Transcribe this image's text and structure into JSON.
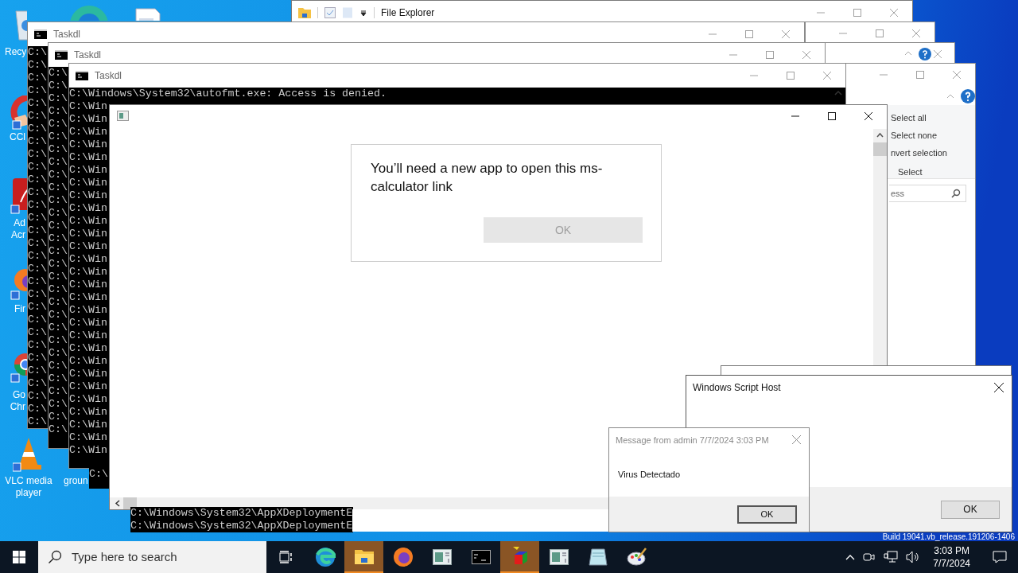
{
  "desktop_icons": [
    {
      "kind": "recycle",
      "lines": [
        "Recy"
      ]
    },
    {
      "kind": "edge"
    },
    {
      "kind": "file"
    },
    {
      "kind": "ccleaner",
      "lines": [
        "CCl"
      ]
    },
    {
      "kind": "acrobat",
      "lines": [
        "Ad",
        "Acr"
      ]
    },
    {
      "kind": "firefox",
      "lines": [
        "Fir"
      ]
    },
    {
      "kind": "chrome",
      "lines": [
        "Go",
        "Chr"
      ]
    },
    {
      "kind": "vlc",
      "lines": [
        "VLC media",
        "player"
      ]
    },
    {
      "kind": "none",
      "lines": [
        "groun"
      ]
    }
  ],
  "file_explorer": {
    "title": "File Explorer"
  },
  "explorer_ribbon": {
    "items": [
      "Select all",
      "Select none",
      "nvert selection"
    ],
    "group": "Select",
    "search_value": "ess"
  },
  "consoles": [
    {
      "title": "Taskdl",
      "lines": [
        "C:\\",
        "C:\\",
        "C:\\",
        "C:\\",
        "C:\\",
        "C:\\",
        "C:\\",
        "C:\\",
        "C:\\",
        "C:\\",
        "C:\\",
        "C:\\",
        "C:\\",
        "C:\\",
        "C:\\",
        "C:\\",
        "C:\\",
        "C:\\",
        "C:\\",
        "C:\\",
        "C:\\",
        "C:\\",
        "C:\\",
        "C:\\",
        "C:\\",
        "C:\\",
        "C:\\",
        "C:\\",
        "C:\\",
        "C:\\"
      ]
    },
    {
      "title": "Taskdl",
      "lines": [
        "C:\\",
        "C:\\",
        "C:\\",
        "C:\\",
        "C:\\",
        "C:\\",
        "C:\\",
        "C:\\",
        "C:\\",
        "C:\\",
        "C:\\",
        "C:\\",
        "C:\\",
        "C:\\",
        "C:\\",
        "C:\\",
        "C:\\",
        "C:\\",
        "C:\\",
        "C:\\",
        "C:\\",
        "C:\\",
        "C:\\",
        "C:\\",
        "C:\\",
        "C:\\",
        "C:\\",
        "C:\\",
        "C:\\"
      ]
    },
    {
      "title": "Taskdl",
      "lines": [
        "C:\\Windows\\System32\\autofmt.exe: Access is denied.",
        "C:\\Win",
        "C:\\Win",
        "C:\\Win",
        "C:\\Win",
        "C:\\Win",
        "C:\\Win",
        "C:\\Win",
        "C:\\Win",
        "C:\\Win",
        "C:\\Win",
        "C:\\Win",
        "C:\\Win",
        "C:\\Win",
        "C:\\Win",
        "C:\\Win",
        "C:\\Win",
        "C:\\Win",
        "C:\\Win",
        "C:\\Win",
        "C:\\Win",
        "C:\\Win",
        "C:\\Win",
        "C:\\Win",
        "C:\\Win",
        "C:\\Win",
        "C:\\Win",
        "C:\\Win",
        "C:\\Win"
      ]
    }
  ],
  "console_fragments": [
    {
      "lines": [
        "C:\\"
      ]
    },
    {
      "lines": [
        "C:\\Windows\\System32\\AppXDeploymentE",
        "C:\\Windows\\System32\\AppXDeploymentE"
      ]
    }
  ],
  "app_dialog": {
    "message": "You’ll need a new app to open this ms-calculator link",
    "ok_button": {
      "label": "OK",
      "disabled": true
    }
  },
  "script_host": {
    "title": "Windows Script Host",
    "ok_label": "OK"
  },
  "message_box": {
    "title": "Message from admin 7/7/2024 3:03 PM",
    "text": "Virus Detectado",
    "ok_label": "OK"
  },
  "build_text": "Build 19041.vb_release.191206-1406",
  "taskbar": {
    "search_placeholder": "Type here to search",
    "items": [
      {
        "kind": "taskview",
        "active": false
      },
      {
        "kind": "edge",
        "active": false
      },
      {
        "kind": "explorer",
        "active": true
      },
      {
        "kind": "firefox",
        "active": false
      },
      {
        "kind": "window",
        "active": false
      },
      {
        "kind": "cmd",
        "active": false
      },
      {
        "kind": "cube",
        "active": true
      },
      {
        "kind": "window",
        "active": false
      },
      {
        "kind": "notepad",
        "active": false
      },
      {
        "kind": "paint",
        "active": false
      }
    ],
    "time": "3:03 PM",
    "date": "7/7/2024"
  }
}
